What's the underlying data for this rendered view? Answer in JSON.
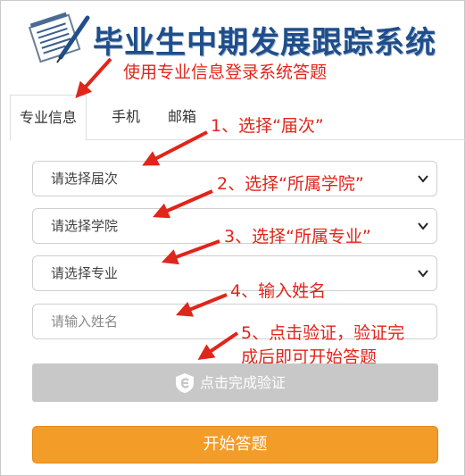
{
  "header": {
    "title": "毕业生中期发展跟踪系统",
    "logo_icon": "notepad-pen-icon",
    "title_color": "#1f4e8a"
  },
  "tabs": [
    {
      "label": "专业信息",
      "active": true
    },
    {
      "label": "手机",
      "active": false
    },
    {
      "label": "邮箱",
      "active": false
    }
  ],
  "form": {
    "session_select": "请选择届次",
    "college_select": "请选择学院",
    "major_select": "请选择专业",
    "name_placeholder": "请输入姓名",
    "captcha_label": "点击完成验证",
    "captcha_icon": "shield-e-icon",
    "start_label": "开始答题"
  },
  "annotations": {
    "intro": "使用专业信息登录系统答题",
    "step1": "1、选择“届次”",
    "step2": "2、选择“所属学院”",
    "step3": "3、选择“所属专业”",
    "step4": "4、输入姓名",
    "step5_line1": "5、点击验证，验证完",
    "step5_line2": "成后即可开始答题",
    "color": "#e0251b"
  },
  "colors": {
    "start_button": "#f39c27",
    "captcha_button": "#c8c8c8"
  }
}
